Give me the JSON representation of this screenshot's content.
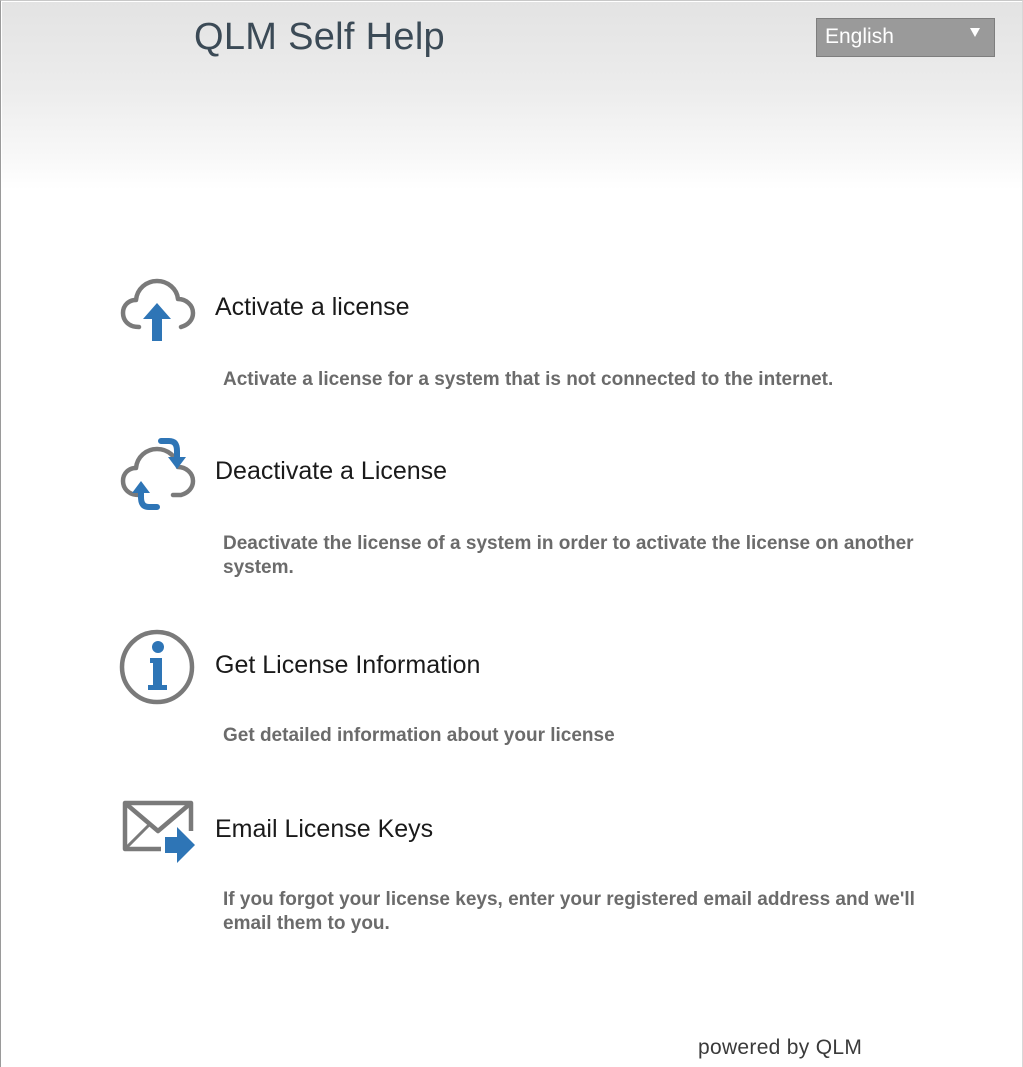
{
  "header": {
    "title": "QLM Self Help",
    "language": {
      "selected": "English",
      "icon": "caret-down-icon"
    }
  },
  "items": [
    {
      "title": "Activate a license",
      "description": "Activate a license for a system that is not connected to the internet.",
      "icon": "cloud-upload-icon"
    },
    {
      "title": "Deactivate a License",
      "description": "Deactivate the license of a system in order to activate the license on another system.",
      "icon": "cloud-sync-icon"
    },
    {
      "title": "Get License Information",
      "description": "Get detailed information about your license",
      "icon": "info-icon"
    },
    {
      "title": "Email License Keys",
      "description": "If you forgot your license keys, enter your registered email address and we'll email them to you.",
      "icon": "email-forward-icon"
    }
  ],
  "footer": {
    "text": "powered by QLM"
  },
  "colors": {
    "icon_gray": "#7a7a7a",
    "icon_blue": "#2e75b6",
    "dropdown_bg": "#9a9a9a",
    "title_color": "#3b4a56"
  }
}
